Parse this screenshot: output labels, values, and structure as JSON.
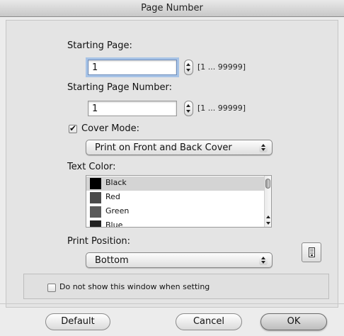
{
  "window": {
    "title": "Page Number"
  },
  "starting_page": {
    "label": "Starting Page:",
    "value": "1",
    "range": "[1 ... 99999]"
  },
  "starting_page_number": {
    "label": "Starting Page Number:",
    "value": "1",
    "range": "[1 ... 99999]"
  },
  "cover_mode": {
    "label": "Cover Mode:",
    "checked": true,
    "selected": "Print on Front and Back Cover"
  },
  "text_color": {
    "label": "Text Color:",
    "options": [
      {
        "label": "Black",
        "color": "#000000",
        "selected": true
      },
      {
        "label": "Red",
        "color": "#4a4a4a",
        "selected": false
      },
      {
        "label": "Green",
        "color": "#5a5a5a",
        "selected": false
      },
      {
        "label": "Blue",
        "color": "#222222",
        "selected": false
      }
    ]
  },
  "print_position": {
    "label": "Print Position:",
    "selected": "Bottom",
    "preview_icon": "page-number-position-icon"
  },
  "dont_show": {
    "label": "Do not show this window when setting",
    "checked": false
  },
  "buttons": {
    "default_label": "Default",
    "cancel_label": "Cancel",
    "ok_label": "OK"
  }
}
